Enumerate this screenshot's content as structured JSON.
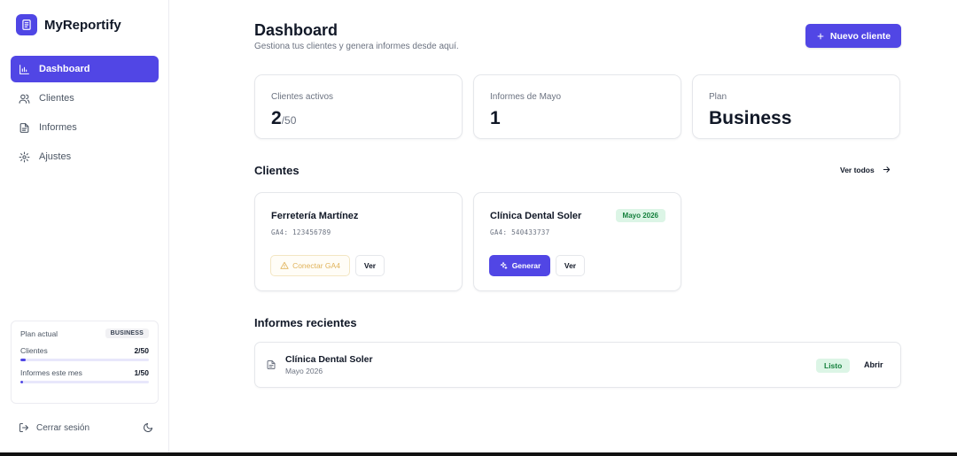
{
  "app": {
    "name": "MyReportify"
  },
  "sidebar": {
    "items": [
      {
        "label": "Dashboard",
        "icon": "bar-chart-icon",
        "active": true
      },
      {
        "label": "Clientes",
        "icon": "users-icon"
      },
      {
        "label": "Informes",
        "icon": "file-text-icon"
      },
      {
        "label": "Ajustes",
        "icon": "gear-icon"
      }
    ],
    "plan": {
      "label": "Plan actual",
      "badge": "BUSINESS",
      "clients_label": "Clientes",
      "clients_value": "2/50",
      "clients_progress": 0.04,
      "reports_label": "Informes este mes",
      "reports_value": "1/50",
      "reports_progress": 0.02
    },
    "logout_label": "Cerrar sesión"
  },
  "header": {
    "title": "Dashboard",
    "subtitle": "Gestiona tus clientes y genera informes desde aquí.",
    "new_client_label": "Nuevo cliente"
  },
  "stats": {
    "active_clients_label": "Clientes activos",
    "active_clients_value": "2",
    "active_clients_max": "/50",
    "reports_label": "Informes de Mayo",
    "reports_value": "1",
    "plan_label": "Plan",
    "plan_value": "Business"
  },
  "clients_section": {
    "title": "Clientes",
    "see_all": "Ver todos",
    "cards": [
      {
        "name": "Ferretería Martínez",
        "ga4": "GA4: 123456789",
        "connect_label": "Conectar GA4",
        "view_label": "Ver"
      },
      {
        "name": "Clínica Dental Soler",
        "ga4": "GA4: 540433737",
        "badge": "Mayo 2026",
        "generate_label": "Generar",
        "view_label": "Ver"
      }
    ]
  },
  "reports_section": {
    "title": "Informes recientes",
    "rows": [
      {
        "name": "Clínica Dental Soler",
        "date": "Mayo 2026",
        "status": "Listo",
        "open_label": "Abrir"
      }
    ]
  },
  "colors": {
    "accent": "#5146e5",
    "success_bg": "#dcf5e6",
    "success_text": "#15803d",
    "warning": "#e0b35a"
  }
}
